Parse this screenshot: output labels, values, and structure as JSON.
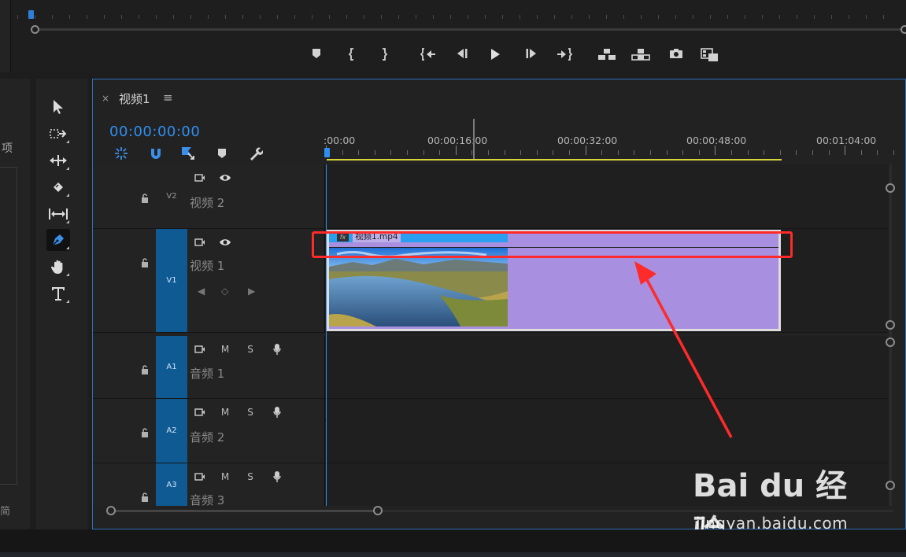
{
  "monitor": {
    "transport_icons": [
      "add-marker-icon",
      "mark-in-icon",
      "mark-out-icon",
      "go-to-in-icon",
      "step-back-icon",
      "play-icon",
      "step-forward-icon",
      "go-to-out-icon",
      "insert-icon",
      "overwrite-icon",
      "export-frame-icon",
      "button-editor-icon"
    ]
  },
  "project": {
    "label": "项",
    "foot": "简"
  },
  "tools": [
    "selection-tool-icon",
    "track-select-tool-icon",
    "ripple-edit-tool-icon",
    "razor-tool-icon",
    "slip-tool-icon",
    "pen-tool-icon",
    "hand-tool-icon",
    "type-tool-icon"
  ],
  "timeline": {
    "close": "×",
    "title": "视频1",
    "menu": "≡",
    "timecode": "00:00:00:00",
    "ruler_labels": [
      ":00:00",
      "00:00:16:00",
      "00:00:32:00",
      "00:00:48:00",
      "00:01:04:00"
    ],
    "tracks": [
      {
        "id": "V2",
        "name": "视频 2",
        "type": "video",
        "active": false
      },
      {
        "id": "V1",
        "name": "视频 1",
        "type": "video",
        "active": true
      },
      {
        "id": "A1",
        "name": "音频 1",
        "type": "audio",
        "active": true
      },
      {
        "id": "A2",
        "name": "音频 2",
        "type": "audio",
        "active": true
      },
      {
        "id": "A3",
        "name": "音频 3",
        "type": "audio",
        "active": true
      }
    ],
    "audio_buttons": {
      "mute": "M",
      "solo": "S"
    },
    "clip": {
      "fx": "fx",
      "name": "视频1.mp4"
    }
  },
  "watermark": {
    "brand": "Bai du 经验",
    "url": "jingyan.baidu.com"
  },
  "colors": {
    "accent": "#2f8ff0",
    "clip": "#a88fe0",
    "highlight": "#ff2a2a",
    "track_active": "#0f5a92"
  }
}
